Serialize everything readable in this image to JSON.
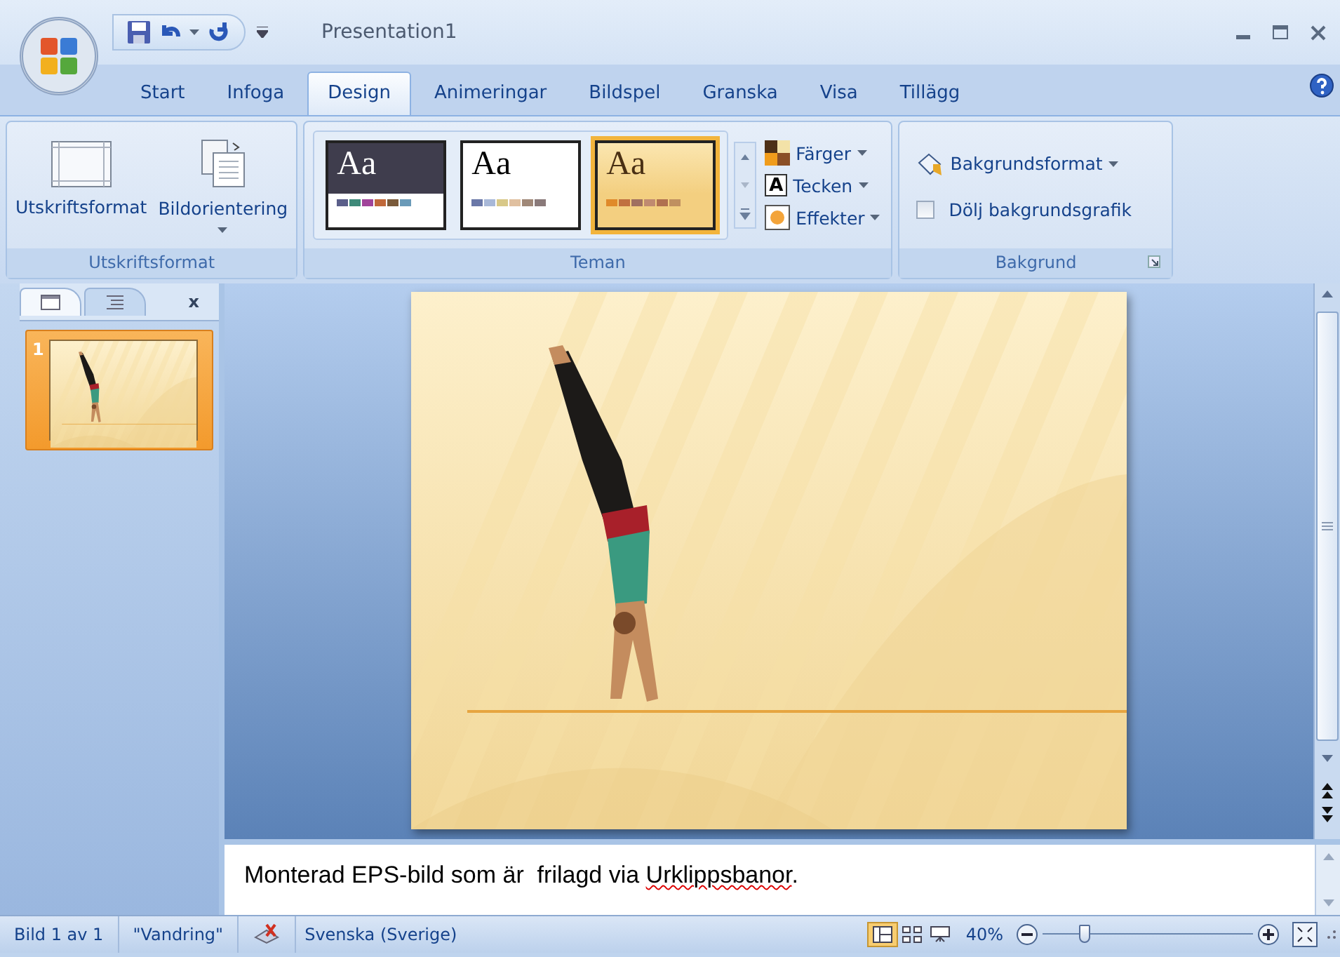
{
  "window": {
    "title": "Presentation1"
  },
  "tabs": [
    {
      "label": "Start",
      "selected": false
    },
    {
      "label": "Infoga",
      "selected": false
    },
    {
      "label": "Design",
      "selected": true
    },
    {
      "label": "Animeringar",
      "selected": false
    },
    {
      "label": "Bildspel",
      "selected": false
    },
    {
      "label": "Granska",
      "selected": false
    },
    {
      "label": "Visa",
      "selected": false
    },
    {
      "label": "Tillägg",
      "selected": false
    }
  ],
  "page_setup": {
    "title": "Utskriftsformat",
    "buttons": [
      {
        "label": "Utskriftsformat",
        "kind": "page",
        "dropdown": false
      },
      {
        "label": "Bildorientering",
        "kind": "orientation",
        "dropdown": true
      }
    ]
  },
  "themes": {
    "title": "Teman",
    "gallery": [
      {
        "sample": "Aa",
        "kind": "dark",
        "selected": false
      },
      {
        "sample": "Aa",
        "kind": "plain",
        "selected": false
      },
      {
        "sample": "Aa",
        "kind": "warm",
        "selected": true
      }
    ],
    "options": [
      {
        "label": "Färger",
        "kind": "colors"
      },
      {
        "label": "Tecken",
        "kind": "fonts",
        "glyph": "A"
      },
      {
        "label": "Effekter",
        "kind": "effects"
      }
    ]
  },
  "background": {
    "title": "Bakgrund",
    "format_button": "Bakgrundsformat",
    "hide_graphics": {
      "label": "Dölj bakgrundsgrafik",
      "checked": false
    }
  },
  "slides_pane": {
    "tabs": [
      {
        "kind": "slides",
        "selected": true
      },
      {
        "kind": "outline",
        "selected": false
      }
    ],
    "close": "x",
    "thumbnails": [
      {
        "number": "1",
        "selected": true
      }
    ]
  },
  "notes": [
    {
      "text": "Monterad EPS-bild som är  frilagd via ",
      "misspelled": false
    },
    {
      "text": "Urklippsbanor",
      "misspelled": true
    },
    {
      "text": ".",
      "misspelled": false
    }
  ],
  "status_bar": {
    "slide": "Bild 1 av 1",
    "theme": "\"Vandring\"",
    "language": "Svenska (Sverige)",
    "views": [
      {
        "kind": "normal",
        "selected": true
      },
      {
        "kind": "sorter",
        "selected": false
      },
      {
        "kind": "show",
        "selected": false
      }
    ],
    "zoom": "40%",
    "level": 0.2
  }
}
